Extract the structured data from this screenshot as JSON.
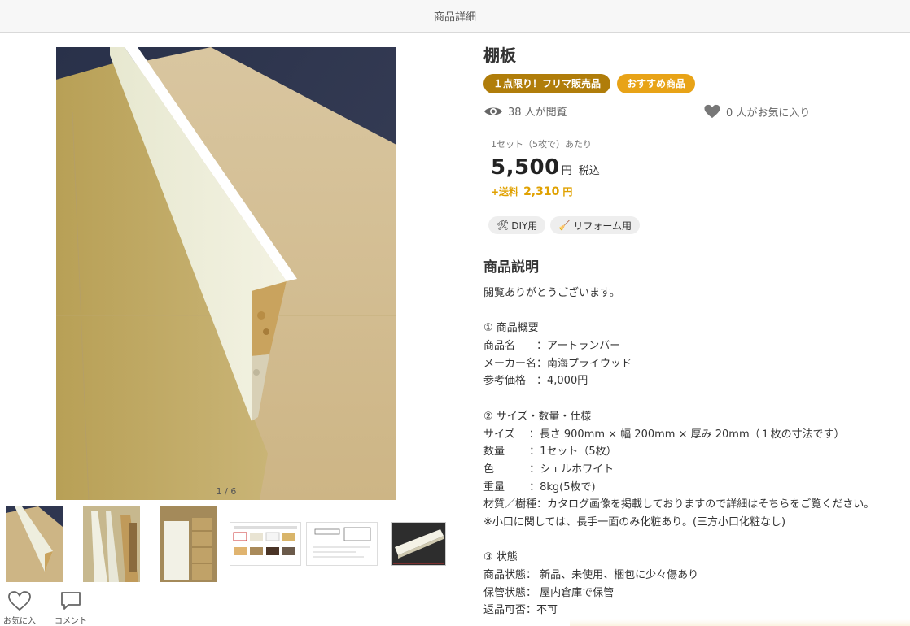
{
  "header": {
    "title": "商品詳細"
  },
  "gallery": {
    "counter": "1 / 6",
    "thumbnails": [
      {
        "name": "thumb-1",
        "kind": "photo"
      },
      {
        "name": "thumb-2",
        "kind": "photo"
      },
      {
        "name": "thumb-3",
        "kind": "photo"
      },
      {
        "name": "thumb-4",
        "kind": "catalog"
      },
      {
        "name": "thumb-5",
        "kind": "diagram"
      },
      {
        "name": "thumb-6",
        "kind": "board"
      }
    ]
  },
  "actions": {
    "favorite_label": "お気に入り",
    "comment_label": "コメント"
  },
  "product": {
    "title": "棚板",
    "badges": [
      "１点限り！フリマ販売品",
      "おすすめ商品"
    ],
    "views": "38 人が閲覧",
    "favorites": "0 人がお気に入り",
    "unit": "1セット（5枚で）あたり",
    "price": "5,500",
    "price_yen": "円",
    "tax": "税込",
    "shipping_label": "+送料",
    "shipping_amount": "2,310",
    "shipping_yen": "円",
    "tags": [
      {
        "icon": "🛠",
        "label": "DIY用"
      },
      {
        "icon": "🧹",
        "label": "リフォーム用"
      }
    ]
  },
  "description": {
    "heading": "商品説明",
    "lines": [
      "閲覧ありがとうございます。",
      "",
      "① 商品概要",
      "商品名　　：アートランバー",
      "メーカー名：南海プライウッド",
      "参考価格　：4,000円",
      "",
      "② サイズ・数量・仕様",
      "サイズ　 ：長さ 900mm × 幅 200mm × 厚み 20mm（１枚の寸法です）",
      "数量　　 ：1セット（5枚）",
      "色　　　 ：シェルホワイト",
      "重量　　 ：8kg(5枚で)",
      "材質／樹種：カタログ画像を掲載しておりますので詳細はそちらをご覧ください。",
      "※小口に関しては、長手一面のみ化粧あり。(三方小口化粧なし)",
      "",
      "③ 状態",
      "商品状態： 新品、未使用、梱包に少々傷あり",
      "保管状態： 屋内倉庫で保管",
      "返品可否：不可"
    ]
  },
  "colors": {
    "badge_primary": "#b07d0a",
    "badge_secondary": "#e8a317",
    "shipping": "#e0a100"
  }
}
